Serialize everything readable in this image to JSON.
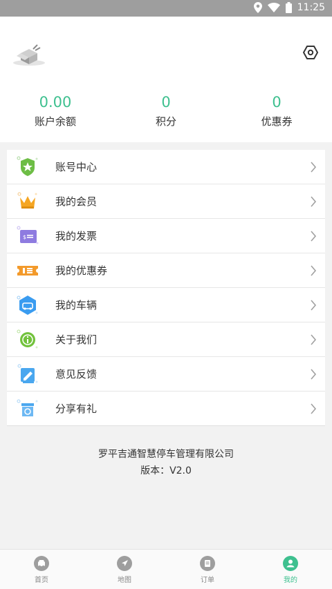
{
  "status": {
    "time": "11:25"
  },
  "header": {
    "settings_icon": "hexagon-settings-icon",
    "stats": [
      {
        "value": "0.00",
        "label": "账户余额"
      },
      {
        "value": "0",
        "label": "积分"
      },
      {
        "value": "0",
        "label": "优惠券"
      }
    ],
    "accent": "#3ec08f"
  },
  "menu": {
    "items": [
      {
        "label": "账号中心",
        "icon": "shield-star-icon"
      },
      {
        "label": "我的会员",
        "icon": "crown-icon"
      },
      {
        "label": "我的发票",
        "icon": "invoice-icon"
      },
      {
        "label": "我的优惠券",
        "icon": "coupon-ticket-icon"
      },
      {
        "label": "我的车辆",
        "icon": "car-hexagon-icon"
      },
      {
        "label": "关于我们",
        "icon": "info-circle-icon"
      },
      {
        "label": "意见反馈",
        "icon": "feedback-icon"
      },
      {
        "label": "分享有礼",
        "icon": "share-gift-icon"
      }
    ]
  },
  "footer": {
    "company": "罗平吉通智慧停车管理有限公司",
    "version": "版本：V2.0"
  },
  "tabbar": {
    "tabs": [
      {
        "label": "首页",
        "icon": "car-icon"
      },
      {
        "label": "地图",
        "icon": "navigation-arrow-icon"
      },
      {
        "label": "订单",
        "icon": "order-list-icon"
      },
      {
        "label": "我的",
        "icon": "person-icon"
      }
    ],
    "active_index": 3
  }
}
